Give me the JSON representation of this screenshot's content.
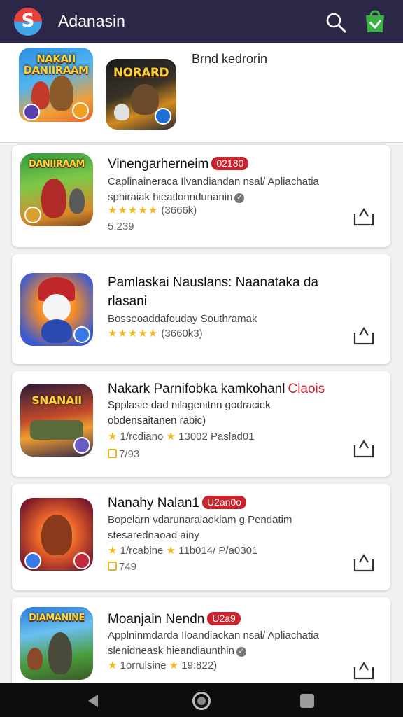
{
  "app": {
    "title": "Adanasin",
    "logo_letter": "S",
    "accent": "#2d2747"
  },
  "toolbar": {
    "search_icon": "search-icon",
    "shop_icon": "shopping-bag-icon"
  },
  "header": {
    "brand_label": "Brnd kedrorin",
    "icons": [
      {
        "text": "NAKAII\nDANIIRAAM"
      },
      {
        "text": "NORARD"
      }
    ]
  },
  "cards": [
    {
      "name": "Vinengarherneim",
      "tag": "02180",
      "desc1": "Caplinaineraca Ilvandiandan nsal/ Apliachatia",
      "desc2": "sphiraiak hieatlonndunanin",
      "stars": "★★★★★",
      "rating": "(3666k)",
      "meta": "5.239",
      "icon_text": "DANIIRAAM"
    },
    {
      "name": "Pamlaskai Nauslans: Naanataka da",
      "name2": "rlasani",
      "desc1": "Bosseoaddafouday Southramak",
      "stars": "★★★★★",
      "rating": "(3660k3)",
      "icon_text": ""
    },
    {
      "name": "Nakark Parnifobka kamkohanl",
      "tag_text": "Claois",
      "desc1": "Spplasie dad nilagenitnn godraciek",
      "desc2": "obdensaitanen rabic)",
      "rating_left": "1/rcdiano",
      "rating_right": "13002 Paslad01",
      "meta": "7/93",
      "icon_text": "SNANAII"
    },
    {
      "name": "Nanahy Nalan1",
      "tag": "U2an0o",
      "desc1": "Bopelarn vdarunaralaoklam g Pendatim",
      "desc2": "stesarednaoad ainy",
      "rating_left": "1/rcabine",
      "rating_right": "11b014/ P/a0301",
      "meta": "749",
      "icon_text": ""
    },
    {
      "name": "Moanjain Nendn",
      "tag": "U2a9",
      "desc1": "Applninmdarda Iloandiackan nsal/ Apliachatia",
      "desc2": "slenidneask hieandiaunthin",
      "rating_left": "1orrulsine",
      "rating_right": "19:822)",
      "icon_text": "DIAMANINE"
    }
  ],
  "nav": {
    "back_icon": "back-icon",
    "home_icon": "home-icon",
    "recent_icon": "recents-icon"
  }
}
